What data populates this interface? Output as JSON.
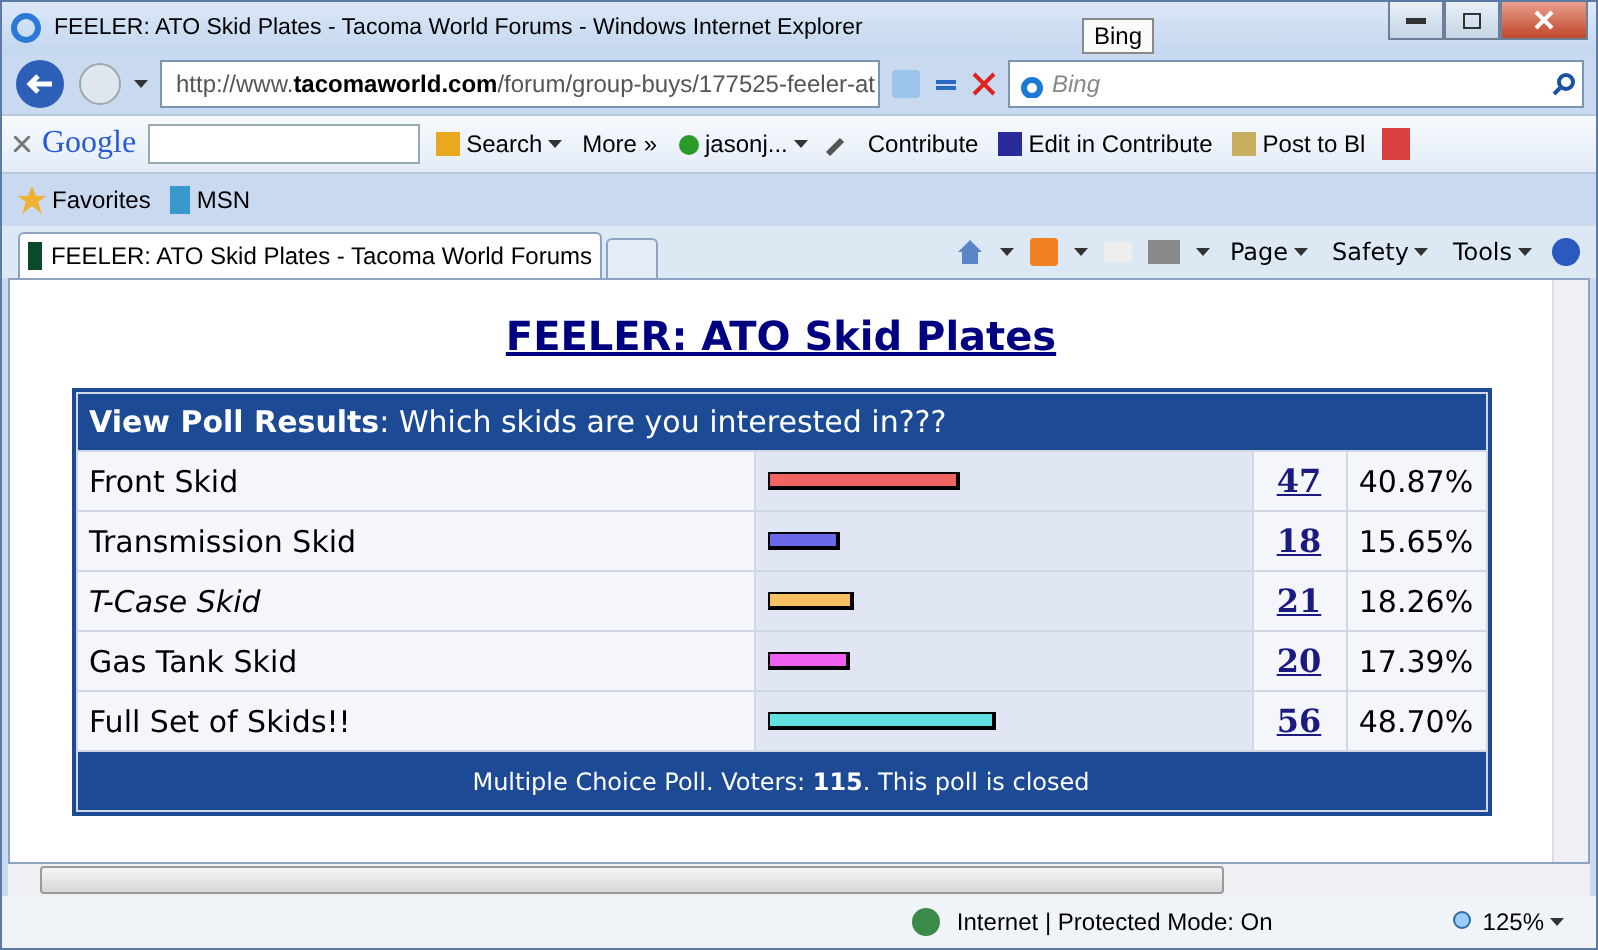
{
  "window": {
    "title": "FEELER: ATO Skid Plates - Tacoma World Forums - Windows Internet Explorer"
  },
  "tooltip": "Bing",
  "address": {
    "prefix": "http://www.",
    "domain": "tacomaworld.com",
    "path": "/forum/group-buys/177525-feeler-at"
  },
  "search": {
    "placeholder": "Bing"
  },
  "google_toolbar": {
    "logo": "Google",
    "search_button": "Search",
    "more": "More »",
    "user": "jasonj...",
    "contribute": "Contribute",
    "edit_in_contribute": "Edit in Contribute",
    "post_to_blog": "Post to Bl"
  },
  "favorites_bar": {
    "favorites": "Favorites",
    "links": [
      "MSN"
    ]
  },
  "tabs": [
    {
      "label": "FEELER: ATO Skid Plates - Tacoma World Forums",
      "selected": true
    }
  ],
  "command_bar": [
    "Page",
    "Safety",
    "Tools"
  ],
  "page": {
    "heading": "FEELER: ATO Skid Plates",
    "poll": {
      "header_bold": "View Poll Results",
      "question": ": Which skids are you interested in???",
      "options": [
        {
          "label": "Front Skid",
          "italic": false,
          "color": "#f06464",
          "level": 0.4087,
          "votes": "47",
          "percent": "40.87%"
        },
        {
          "label": "Transmission Skid",
          "italic": false,
          "color": "#6868e8",
          "level": 0.1565,
          "votes": "18",
          "percent": "15.65%"
        },
        {
          "label": "T-Case Skid",
          "italic": true,
          "color": "#f8c060",
          "level": 0.1826,
          "votes": "21",
          "percent": "18.26%"
        },
        {
          "label": "Gas Tank Skid",
          "italic": false,
          "color": "#f060f0",
          "level": 0.1739,
          "votes": "20",
          "percent": "17.39%"
        },
        {
          "label": "Full Set of Skids!!",
          "italic": false,
          "color": "#60e0e0",
          "level": 0.487,
          "votes": "56",
          "percent": "48.70%"
        }
      ],
      "footer": "Multiple Choice Poll. Voters: **115**. This poll is closed"
    }
  },
  "status_bar": {
    "zone": "Internet | Protected Mode: On",
    "zoom": "125%"
  }
}
